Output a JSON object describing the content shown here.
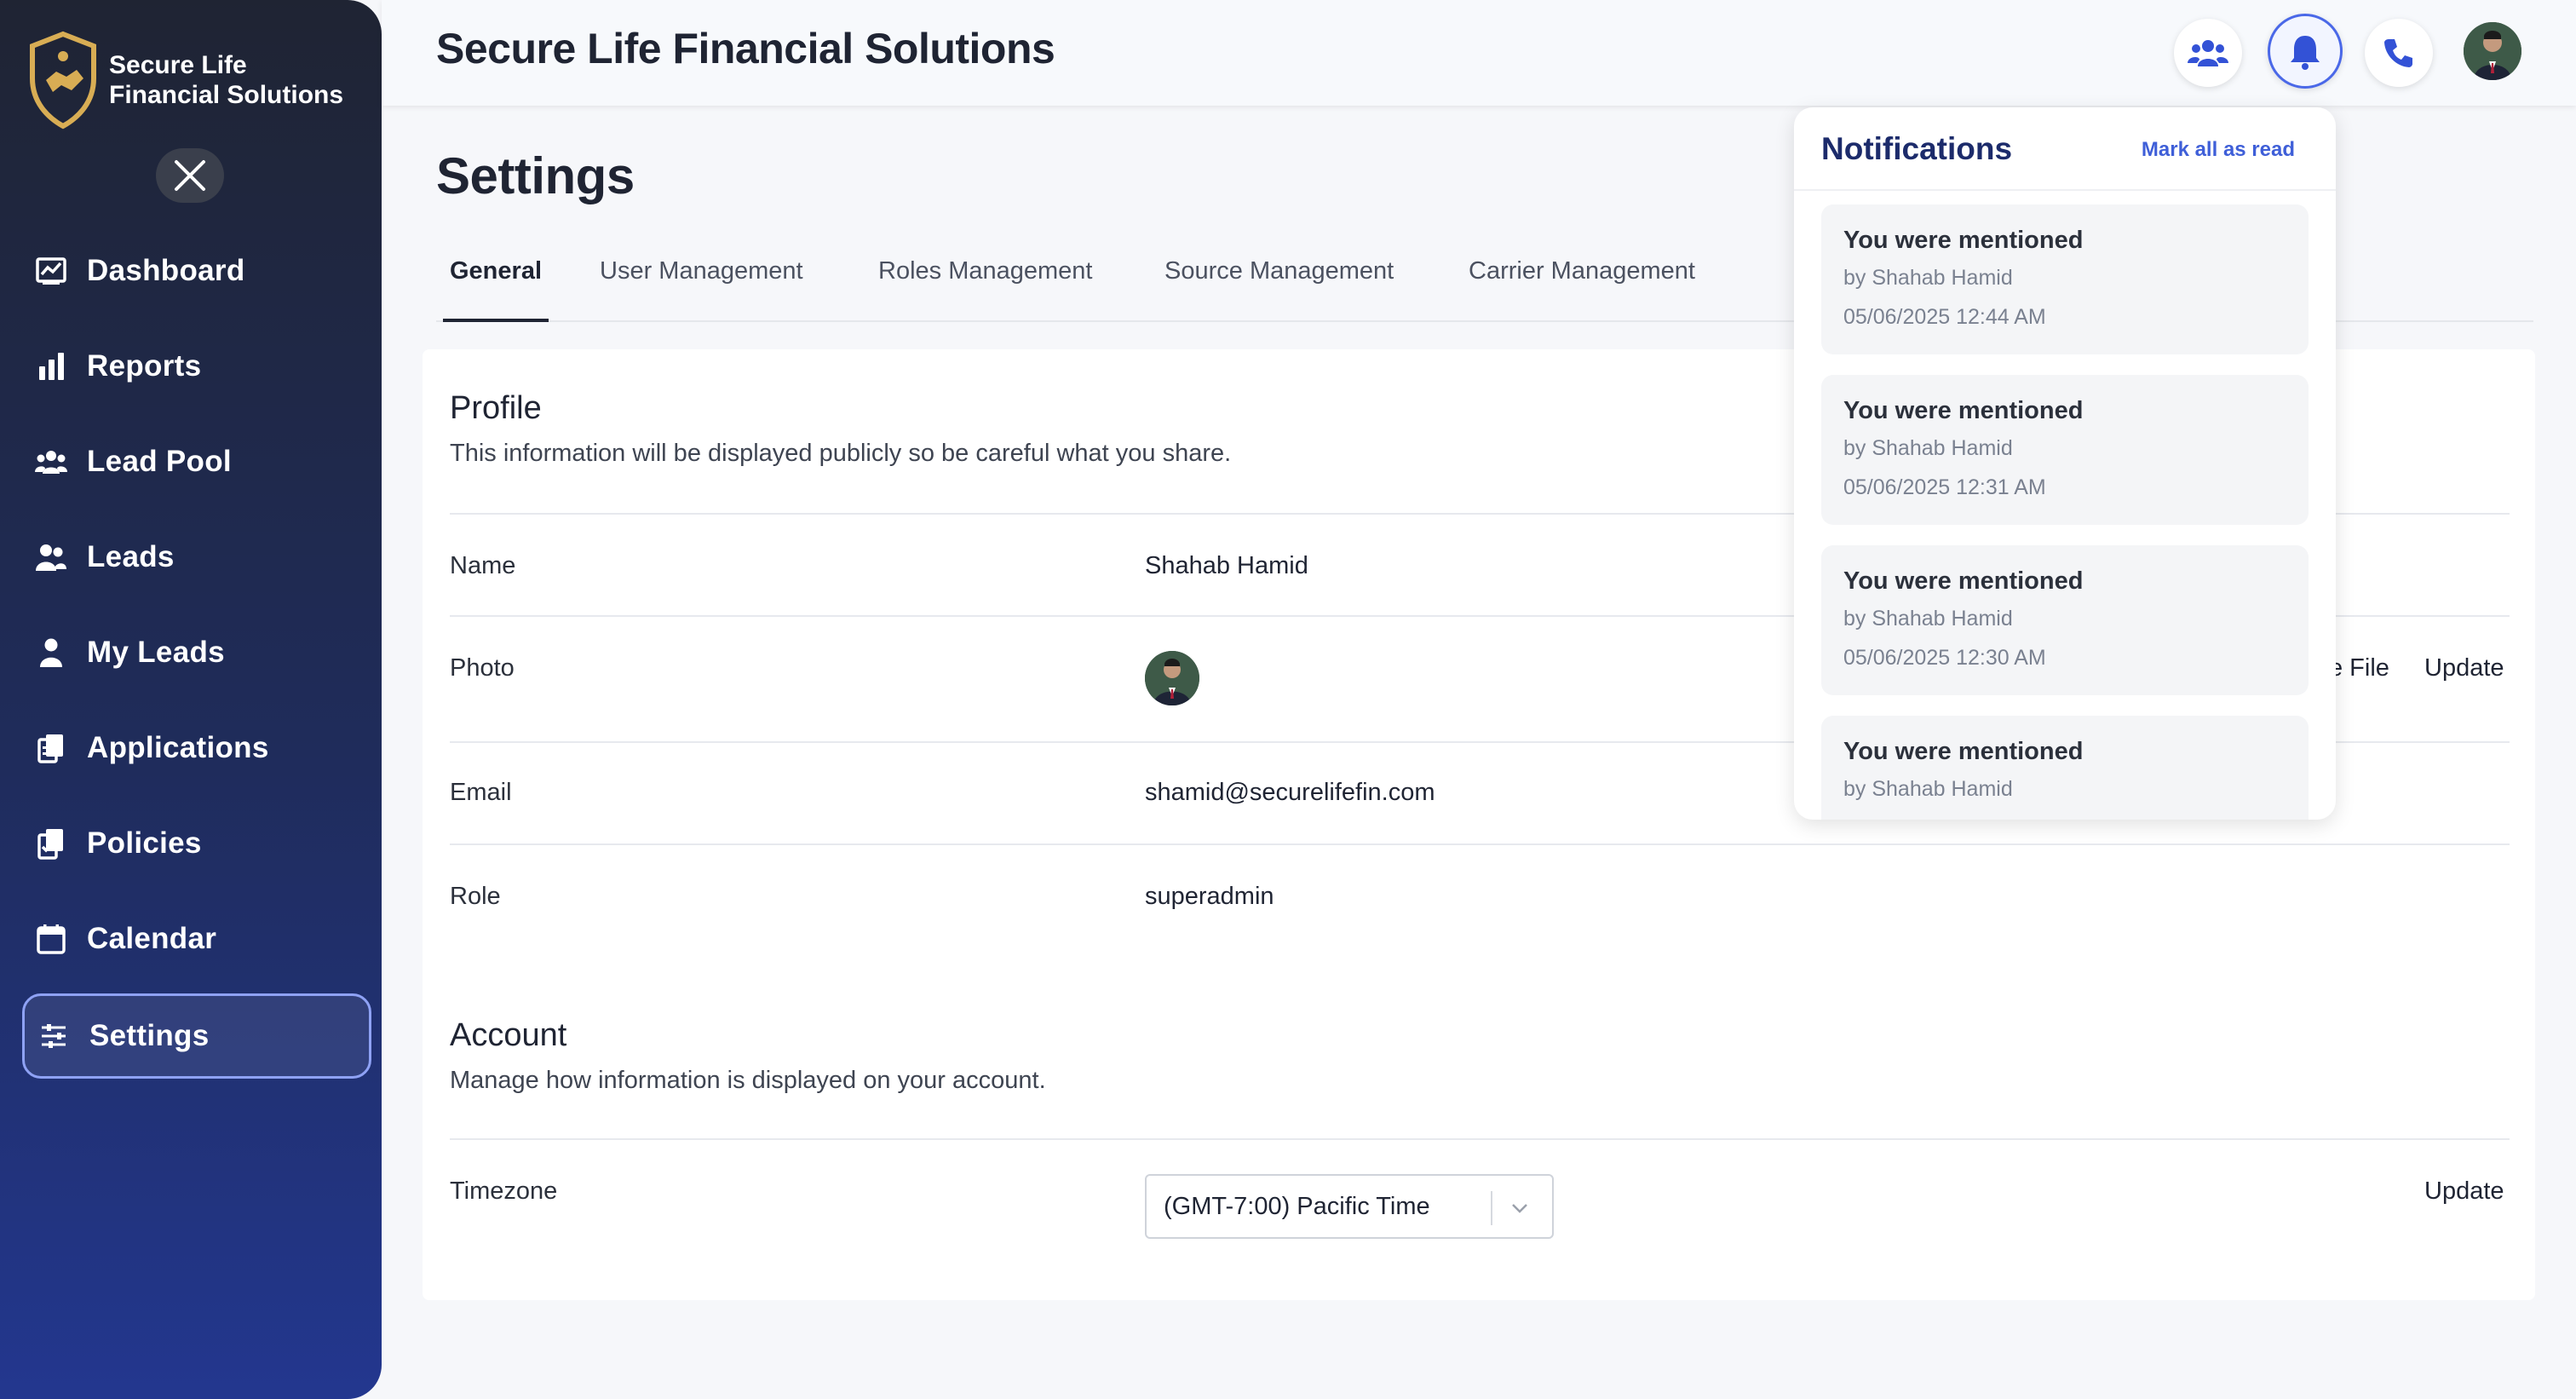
{
  "brand": {
    "name_line1": "Secure Life",
    "name_line2": "Financial Solutions"
  },
  "sidebar": {
    "items": [
      {
        "label": "Dashboard",
        "icon": "dashboard-chart-icon"
      },
      {
        "label": "Reports",
        "icon": "bar-chart-icon"
      },
      {
        "label": "Lead Pool",
        "icon": "group-icon"
      },
      {
        "label": "Leads",
        "icon": "users-icon"
      },
      {
        "label": "My Leads",
        "icon": "user-icon"
      },
      {
        "label": "Applications",
        "icon": "documents-icon"
      },
      {
        "label": "Policies",
        "icon": "policy-docs-icon"
      },
      {
        "label": "Calendar",
        "icon": "calendar-icon"
      },
      {
        "label": "Settings",
        "icon": "sliders-icon",
        "active": true
      }
    ]
  },
  "header": {
    "title": "Secure Life Financial Solutions",
    "icons": [
      "team-icon",
      "bell-icon",
      "phone-icon",
      "user-avatar"
    ]
  },
  "page": {
    "title": "Settings",
    "tabs": [
      "General",
      "User Management",
      "Roles Management",
      "Source Management",
      "Carrier Management"
    ],
    "active_tab": "General"
  },
  "profile": {
    "title": "Profile",
    "description": "This information will be displayed publicly so be careful what you share.",
    "rows": {
      "name_label": "Name",
      "name_value": "Shahab Hamid",
      "photo_label": "Photo",
      "photo_action_partial": "e File",
      "photo_update": "Update",
      "email_label": "Email",
      "email_value": "shamid@securelifefin.com",
      "role_label": "Role",
      "role_value": "superadmin"
    }
  },
  "account": {
    "title": "Account",
    "description": "Manage how information is displayed on your account.",
    "timezone_label": "Timezone",
    "timezone_value": "(GMT-7:00) Pacific Time",
    "update": "Update"
  },
  "notifications": {
    "title": "Notifications",
    "mark_all": "Mark all as read",
    "items": [
      {
        "title": "You were mentioned",
        "by": "by Shahab Hamid",
        "date": "05/06/2025 12:44 AM"
      },
      {
        "title": "You were mentioned",
        "by": "by Shahab Hamid",
        "date": "05/06/2025 12:31 AM"
      },
      {
        "title": "You were mentioned",
        "by": "by Shahab Hamid",
        "date": "05/06/2025 12:30 AM"
      },
      {
        "title": "You were mentioned",
        "by": "by Shahab Hamid",
        "date": ""
      }
    ]
  },
  "colors": {
    "sidebar_top": "#1f2433",
    "sidebar_bottom": "#23378f",
    "accent": "#3f5fd8",
    "brand_gold": "#d8ad54"
  }
}
